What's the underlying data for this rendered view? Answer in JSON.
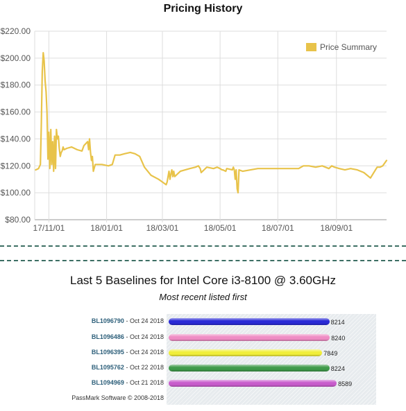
{
  "pricing": {
    "title": "Pricing History",
    "legend_label": "Price Summary"
  },
  "baselines": {
    "title": "Last 5 Baselines for Intel Core i3-8100 @ 3.60GHz",
    "subtitle": "Most recent listed first",
    "copyright": "PassMark Software © 2008-2018",
    "entries": [
      {
        "id": "BL1096790",
        "date": "Oct 24 2018",
        "score": "8214",
        "color": "#2a2ad6"
      },
      {
        "id": "BL1096486",
        "date": "Oct 24 2018",
        "score": "8240",
        "color": "#ef8cc4"
      },
      {
        "id": "BL1096395",
        "date": "Oct 24 2018",
        "score": "7849",
        "color": "#f0ee3a"
      },
      {
        "id": "BL1095762",
        "date": "Oct 22 2018",
        "score": "8224",
        "color": "#3f9a4a"
      },
      {
        "id": "BL1094969",
        "date": "Oct 21 2018",
        "score": "8589",
        "color": "#c85ccc"
      }
    ]
  },
  "chart_data": [
    {
      "type": "line",
      "title": "Pricing History",
      "xlabel": "",
      "ylabel": "",
      "x_tick_labels": [
        "17/11/01",
        "18/01/01",
        "18/03/01",
        "18/05/01",
        "18/07/01",
        "18/09/01"
      ],
      "y_tick_labels": [
        "$80.00",
        "$100.00",
        "$120.00",
        "$140.00",
        "$160.00",
        "$180.00",
        "$200.00",
        "$220.00"
      ],
      "ylim": [
        80,
        220
      ],
      "grid": true,
      "legend_position": "top-right",
      "color": "#e8c34a",
      "series": [
        {
          "name": "Price Summary",
          "x": [
            "2017-10-18",
            "2017-10-21",
            "2017-10-23",
            "2017-10-24",
            "2017-10-25",
            "2017-10-26",
            "2017-10-27",
            "2017-10-28",
            "2017-10-29",
            "2017-10-30",
            "2017-10-31",
            "2017-11-01",
            "2017-11-02",
            "2017-11-03",
            "2017-11-04",
            "2017-11-05",
            "2017-11-06",
            "2017-11-07",
            "2017-11-08",
            "2017-11-09",
            "2017-11-10",
            "2017-11-11",
            "2017-11-12",
            "2017-11-13",
            "2017-11-14",
            "2017-11-15",
            "2017-11-16",
            "2017-11-17",
            "2017-11-20",
            "2017-11-25",
            "2017-12-01",
            "2017-12-06",
            "2017-12-08",
            "2017-12-12",
            "2017-12-13",
            "2017-12-14",
            "2017-12-15",
            "2017-12-16",
            "2017-12-17",
            "2017-12-18",
            "2017-12-20",
            "2017-12-27",
            "2018-01-03",
            "2018-01-07",
            "2018-01-10",
            "2018-01-15",
            "2018-01-20",
            "2018-01-26",
            "2018-01-31",
            "2018-02-05",
            "2018-02-10",
            "2018-02-17",
            "2018-02-25",
            "2018-03-01",
            "2018-03-05",
            "2018-03-06",
            "2018-03-08",
            "2018-03-09",
            "2018-03-10",
            "2018-03-11",
            "2018-03-12",
            "2018-03-13",
            "2018-03-14",
            "2018-03-20",
            "2018-03-30",
            "2018-04-05",
            "2018-04-08",
            "2018-04-10",
            "2018-04-11",
            "2018-04-17",
            "2018-04-24",
            "2018-04-28",
            "2018-05-01",
            "2018-05-03",
            "2018-05-04",
            "2018-05-07",
            "2018-05-08",
            "2018-05-14",
            "2018-05-15",
            "2018-05-16",
            "2018-05-17",
            "2018-05-18",
            "2018-05-19",
            "2018-05-20",
            "2018-05-21",
            "2018-05-25",
            "2018-06-10",
            "2018-06-30",
            "2018-07-05",
            "2018-07-07",
            "2018-07-10",
            "2018-07-13",
            "2018-07-17",
            "2018-07-20",
            "2018-07-23",
            "2018-07-28",
            "2018-08-03",
            "2018-08-10",
            "2018-08-17",
            "2018-08-24",
            "2018-08-27",
            "2018-08-30",
            "2018-09-04",
            "2018-09-10",
            "2018-09-16",
            "2018-09-23",
            "2018-09-30",
            "2018-10-07",
            "2018-10-14",
            "2018-10-17",
            "2018-10-20",
            "2018-10-21",
            "2018-10-24"
          ],
          "y": [
            117,
            118,
            121,
            150,
            190,
            204,
            198,
            183,
            175,
            160,
            125,
            145,
            118,
            147,
            121,
            138,
            116,
            142,
            118,
            147,
            140,
            142,
            133,
            127,
            130,
            131,
            134,
            132,
            133,
            134,
            132,
            131,
            135,
            138,
            132,
            140,
            130,
            124,
            127,
            116,
            121,
            121,
            120,
            121,
            128,
            128,
            129,
            130,
            129,
            127,
            119,
            113,
            110,
            108,
            106,
            108,
            116,
            110,
            114,
            117,
            112,
            116,
            112,
            116,
            118,
            119,
            120,
            118,
            115,
            119,
            118,
            119,
            118,
            117,
            117,
            116,
            118,
            117,
            119,
            117,
            110,
            117,
            103,
            100,
            117,
            116,
            118,
            118,
            118,
            118,
            118,
            118,
            118,
            118,
            118,
            120,
            120,
            119,
            120,
            118,
            120,
            119,
            118,
            117,
            118,
            117,
            115,
            111,
            119,
            119,
            120,
            121,
            124
          ]
        }
      ]
    },
    {
      "type": "bar",
      "title": "Last 5 Baselines for Intel Core i3-8100 @ 3.60GHz",
      "subtitle": "Most recent listed first",
      "orientation": "horizontal",
      "categories": [
        "BL1096790 - Oct 24 2018",
        "BL1096486 - Oct 24 2018",
        "BL1096395 - Oct 24 2018",
        "BL1095762 - Oct 22 2018",
        "BL1094969 - Oct 21 2018"
      ],
      "values": [
        8214,
        8240,
        7849,
        8224,
        8589
      ],
      "xlim": [
        0,
        9400
      ]
    }
  ]
}
